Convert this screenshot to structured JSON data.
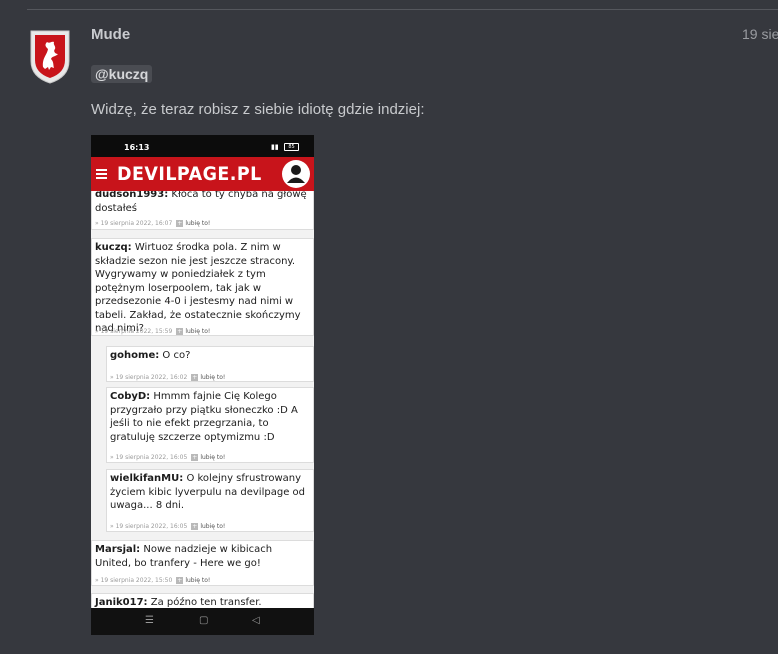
{
  "post": {
    "author": "Mude",
    "date": "19 sie",
    "mention": "@kuczq",
    "message": "Widzę, że teraz robisz z siebie idiotę gdzie indziej:"
  },
  "screenshot": {
    "status_time": "16:13",
    "battery": "85",
    "logo": "DEVILPAGE.PL",
    "like_label": "lubię to!",
    "comments": [
      {
        "user": "dudson1993:",
        "text": "Kłoca to ty chyba na głowę dostałeś",
        "meta": "» 19 sierpnia 2022, 16:07"
      },
      {
        "user": "kuczq:",
        "text": "Wirtuoz środka pola. Z nim w składzie sezon nie jest jeszcze stracony. Wygrywamy w poniedziałek z tym potężnym loserpoolem, tak jak w przedsezonie 4-0 i jestesmy nad nimi w tabeli. Zakład, że ostatecznie skończymy nad nimi?",
        "meta": "» 19 sierpnia 2022, 15:59"
      },
      {
        "user": "gohome:",
        "text": "O co?",
        "meta": "» 19 sierpnia 2022, 16:02"
      },
      {
        "user": "CobyD:",
        "text": "Hmmm fajnie Cię Kolego przygrzało przy piątku słoneczko :D A jeśli to nie efekt przegrzania, to gratuluję szczerze optymizmu :D",
        "meta": "» 19 sierpnia 2022, 16:05"
      },
      {
        "user": "wielkifanMU:",
        "text": "O kolejny sfrustrowany życiem kibic lyverpulu na devilpage od uwaga... 8 dni.",
        "meta": "» 19 sierpnia 2022, 16:05"
      },
      {
        "user": "Marsjal:",
        "text": "Nowe nadzieje w kibicach United, bo tranfery - Here we go!",
        "meta": "» 19 sierpnia 2022, 15:50"
      },
      {
        "user": "Janik017:",
        "text": "Za późno ten transfer.",
        "meta": ""
      }
    ]
  }
}
